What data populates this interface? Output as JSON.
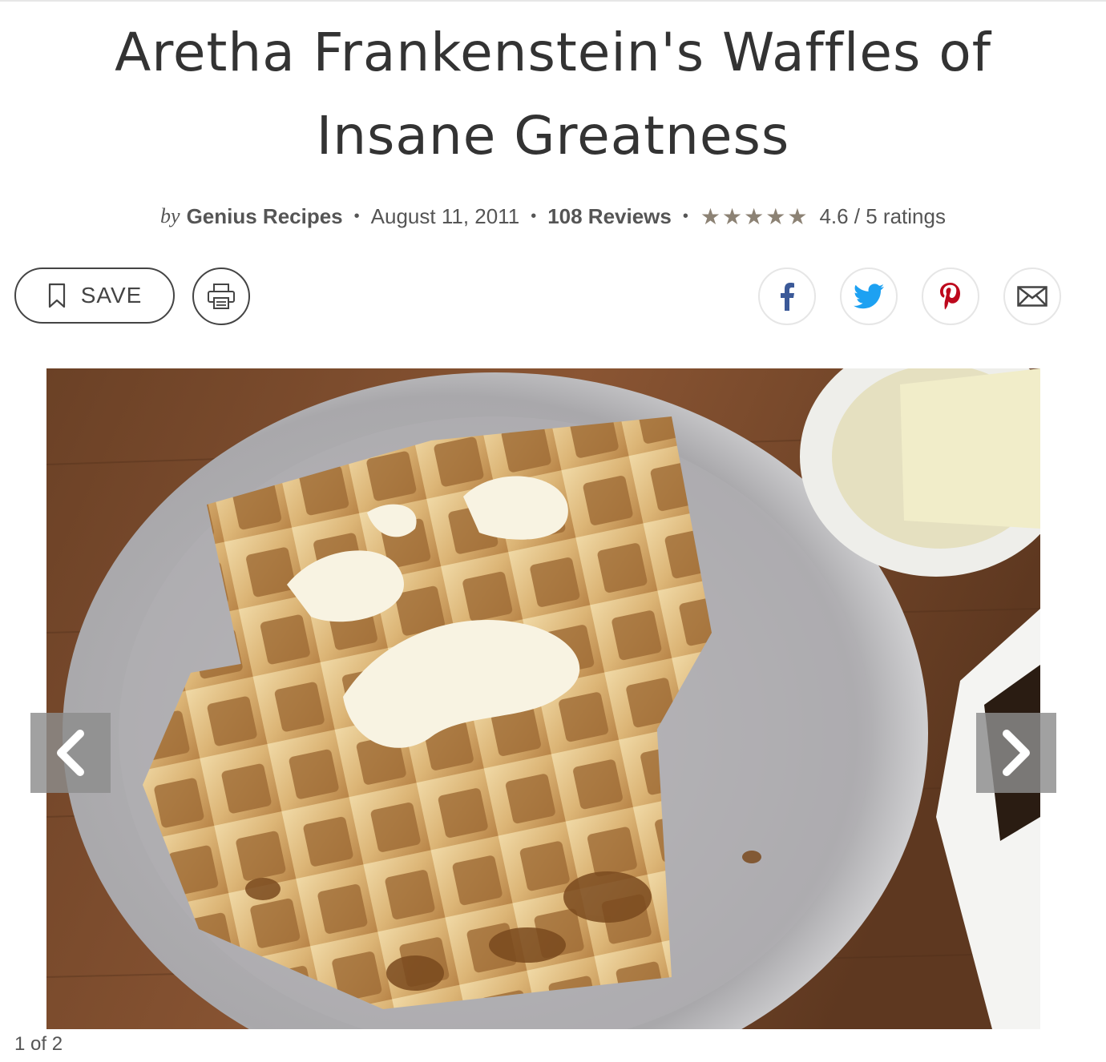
{
  "recipe": {
    "title_line1": "Aretha Frankenstein's Waffles of",
    "title_line2": "Insane Greatness",
    "byline_prefix": "by",
    "author": "Genius Recipes",
    "date": "August 11, 2011",
    "reviews": "108 Reviews",
    "rating_text": "4.6 / 5 ratings",
    "rating_value": 4.6,
    "rating_max": 5,
    "separator": "•"
  },
  "actions": {
    "save_label": "SAVE",
    "save_icon": "bookmark-icon",
    "print_icon": "printer-icon"
  },
  "share": {
    "buttons": [
      {
        "network": "facebook",
        "icon": "facebook-icon",
        "color": "#3b5998"
      },
      {
        "network": "twitter",
        "icon": "twitter-icon",
        "color": "#1da1f2"
      },
      {
        "network": "pinterest",
        "icon": "pinterest-icon",
        "color": "#bd081c"
      },
      {
        "network": "email",
        "icon": "envelope-icon",
        "color": "#444444"
      }
    ]
  },
  "gallery": {
    "counter": "1 of 2",
    "prev_icon": "chevron-left-icon",
    "next_icon": "chevron-right-icon"
  },
  "colors": {
    "star": "#8c8274",
    "text": "#333333",
    "button_border": "#444444"
  }
}
